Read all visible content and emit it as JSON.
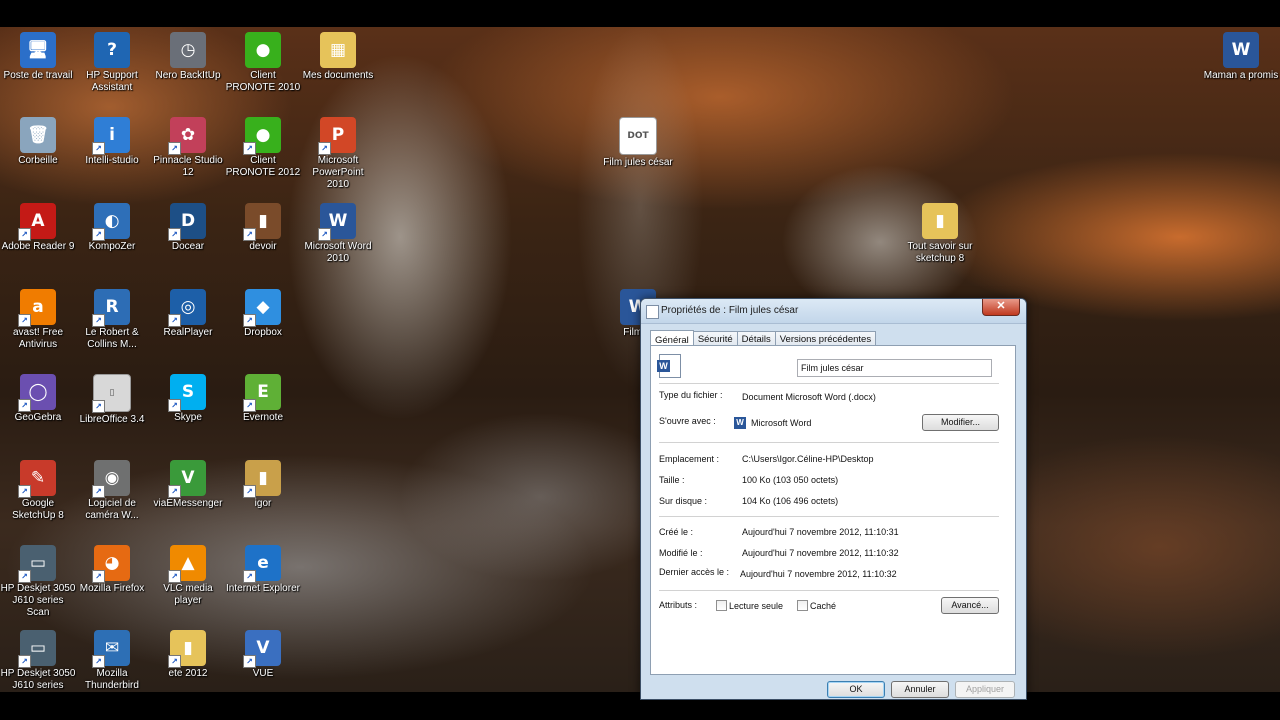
{
  "desktop": {
    "icons": [
      {
        "label": "Poste de travail",
        "glyph": "🖥",
        "color": "#2b6fc9"
      },
      {
        "label": "HP Support Assistant",
        "glyph": "?",
        "color": "#1f66b3"
      },
      {
        "label": "Nero BackItUp",
        "glyph": "◷",
        "color": "#6a6f78"
      },
      {
        "label": "Client PRONOTE 2010",
        "glyph": "●",
        "color": "#38b01c"
      },
      {
        "label": "Mes documents",
        "glyph": "▦",
        "color": "#e6c35a"
      },
      {
        "label": "Corbeille",
        "glyph": "🗑",
        "color": "#8aa5bd"
      },
      {
        "label": "Intelli-studio",
        "glyph": "i",
        "color": "#2f7ed6"
      },
      {
        "label": "Pinnacle Studio 12",
        "glyph": "✿",
        "color": "#c2405a"
      },
      {
        "label": "Client PRONOTE 2012",
        "glyph": "●",
        "color": "#38b01c"
      },
      {
        "label": "Microsoft PowerPoint 2010",
        "glyph": "P",
        "color": "#d24726"
      },
      {
        "label": "Adobe Reader 9",
        "glyph": "A",
        "color": "#c41a16"
      },
      {
        "label": "KompoZer",
        "glyph": "◐",
        "color": "#2e6fb8"
      },
      {
        "label": "Docear",
        "glyph": "D",
        "color": "#1d4f86"
      },
      {
        "label": "devoir",
        "glyph": "▮",
        "color": "#7a4b2a"
      },
      {
        "label": "Microsoft Word 2010",
        "glyph": "W",
        "color": "#2a5699"
      },
      {
        "label": "avast! Free Antivirus",
        "glyph": "a",
        "color": "#f07c00"
      },
      {
        "label": "Le Robert & Collins M...",
        "glyph": "R",
        "color": "#2d6db5"
      },
      {
        "label": "RealPlayer",
        "glyph": "◎",
        "color": "#1d5fa8"
      },
      {
        "label": "Dropbox",
        "glyph": "◆",
        "color": "#2f8fe0"
      },
      {
        "label": "GeoGebra",
        "glyph": "◯",
        "color": "#6b4fb0"
      },
      {
        "label": "LibreOffice 3.4",
        "glyph": "▯",
        "color": "#d8d8d8"
      },
      {
        "label": "Skype",
        "glyph": "S",
        "color": "#00aff0"
      },
      {
        "label": "Evernote",
        "glyph": "E",
        "color": "#5fb036"
      },
      {
        "label": "Google SketchUp 8",
        "glyph": "✎",
        "color": "#c83a2a"
      },
      {
        "label": "Logiciel de caméra W...",
        "glyph": "◉",
        "color": "#6f7070"
      },
      {
        "label": "viaEMessenger",
        "glyph": "V",
        "color": "#3a9a3a"
      },
      {
        "label": "igor",
        "glyph": "▮",
        "color": "#c9a04a"
      },
      {
        "label": "HP Deskjet 3050 J610 series Scan",
        "glyph": "▭",
        "color": "#4a6070"
      },
      {
        "label": "Mozilla Firefox",
        "glyph": "◕",
        "color": "#e66a12"
      },
      {
        "label": "VLC media player",
        "glyph": "▲",
        "color": "#f08a00"
      },
      {
        "label": "Internet Explorer",
        "glyph": "e",
        "color": "#1e72c8"
      },
      {
        "label": "HP Deskjet 3050 J610 series",
        "glyph": "▭",
        "color": "#4a6070"
      },
      {
        "label": "Mozilla Thunderbird",
        "glyph": "✉",
        "color": "#2d6fb5"
      },
      {
        "label": "ete 2012",
        "glyph": "▮",
        "color": "#e6c35a"
      },
      {
        "label": "VUE",
        "glyph": "V",
        "color": "#3a6fc0"
      },
      {
        "label": "Film jules césar",
        "glyph": "DOT",
        "color": "#ffffff"
      },
      {
        "label": "Film ju",
        "glyph": "W",
        "color": "#2a5699"
      },
      {
        "label": "Tout savoir sur sketchup 8",
        "glyph": "▮",
        "color": "#e6c35a"
      },
      {
        "label": "Maman a promis",
        "glyph": "W",
        "color": "#2a5699"
      }
    ]
  },
  "dialog": {
    "title": "Propriétés de : Film jules césar",
    "close_label": "✕",
    "tabs": [
      "Général",
      "Sécurité",
      "Détails",
      "Versions précédentes"
    ],
    "file_name": "Film jules césar",
    "type_label": "Type du fichier :",
    "type_value": "Document Microsoft Word (.docx)",
    "opens_label": "S'ouvre avec :",
    "opens_value": "Microsoft Word",
    "modify_button": "Modifier...",
    "location_label": "Emplacement :",
    "location_value": "C:\\Users\\Igor.Céline-HP\\Desktop",
    "size_label": "Taille :",
    "size_value": "100 Ko (103 050 octets)",
    "disk_label": "Sur disque :",
    "disk_value": "104 Ko (106 496 octets)",
    "created_label": "Créé le :",
    "created_value": "Aujourd'hui 7 novembre 2012, 11:10:31",
    "modified_label": "Modifié le :",
    "modified_value": "Aujourd'hui 7 novembre 2012, 11:10:32",
    "accessed_label": "Dernier accès le :",
    "accessed_value": "Aujourd'hui 7 novembre 2012, 11:10:32",
    "attributes_label": "Attributs :",
    "readonly_label": "Lecture seule",
    "hidden_label": "Caché",
    "advanced_button": "Avancé...",
    "ok_button": "OK",
    "cancel_button": "Annuler",
    "apply_button": "Appliquer"
  }
}
